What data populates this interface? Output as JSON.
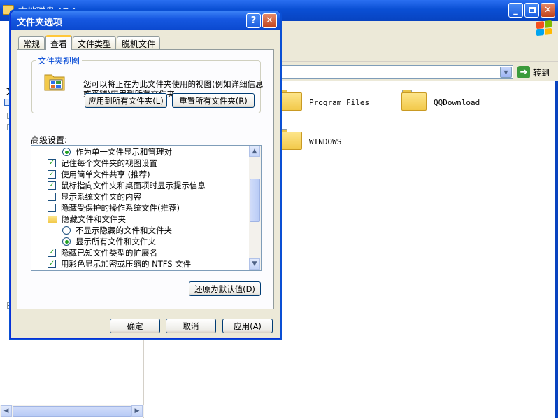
{
  "explorer": {
    "title": "本地磁盘 (C:)",
    "left_pane_fragment": "文",
    "address_go_label": "转到",
    "files": [
      {
        "name": "Program Files"
      },
      {
        "name": "QQDownload"
      },
      {
        "name": "WINDOWS"
      }
    ]
  },
  "dialog": {
    "title": "文件夹选项",
    "help_glyph": "?",
    "close_glyph": "✕",
    "tabs": [
      {
        "label": "常规",
        "active": false
      },
      {
        "label": "查看",
        "active": true
      },
      {
        "label": "文件类型",
        "active": false
      },
      {
        "label": "脱机文件",
        "active": false
      }
    ],
    "folder_views": {
      "group_title": "文件夹视图",
      "description": "您可以将正在为此文件夹使用的视图(例如详细信息或平铺)应用到所有文件夹。",
      "apply_all_button": "应用到所有文件夹(L)",
      "reset_all_button": "重置所有文件夹(R)"
    },
    "advanced": {
      "label": "高级设置:",
      "items": [
        {
          "kind": "radio",
          "indent": true,
          "checked": true,
          "label": "作为单一文件显示和管理对"
        },
        {
          "kind": "checkbox",
          "indent": false,
          "checked": true,
          "label": "记住每个文件夹的视图设置"
        },
        {
          "kind": "checkbox",
          "indent": false,
          "checked": true,
          "label": "使用简单文件共享 (推荐)"
        },
        {
          "kind": "checkbox",
          "indent": false,
          "checked": true,
          "label": "鼠标指向文件夹和桌面项时显示提示信息"
        },
        {
          "kind": "checkbox",
          "indent": false,
          "checked": false,
          "label": "显示系统文件夹的内容"
        },
        {
          "kind": "checkbox",
          "indent": false,
          "checked": false,
          "label": "隐藏受保护的操作系统文件(推荐)"
        },
        {
          "kind": "folder",
          "indent": false,
          "checked": false,
          "label": "隐藏文件和文件夹"
        },
        {
          "kind": "radio",
          "indent": true,
          "checked": false,
          "label": "不显示隐藏的文件和文件夹"
        },
        {
          "kind": "radio",
          "indent": true,
          "checked": true,
          "label": "显示所有文件和文件夹"
        },
        {
          "kind": "checkbox",
          "indent": false,
          "checked": true,
          "label": "隐藏已知文件类型的扩展名"
        },
        {
          "kind": "checkbox",
          "indent": false,
          "checked": true,
          "label": "用彩色显示加密或压缩的 NTFS 文件"
        }
      ]
    },
    "restore_defaults_button": "还原为默认值(D)",
    "ok_button": "确定",
    "cancel_button": "取消",
    "apply_button": "应用(A)"
  },
  "colors": {
    "titlebar_blue": "#0a4fd4",
    "dialog_face": "#ece9d8",
    "group_title_blue": "#0046d5",
    "check_green": "#21a121"
  }
}
